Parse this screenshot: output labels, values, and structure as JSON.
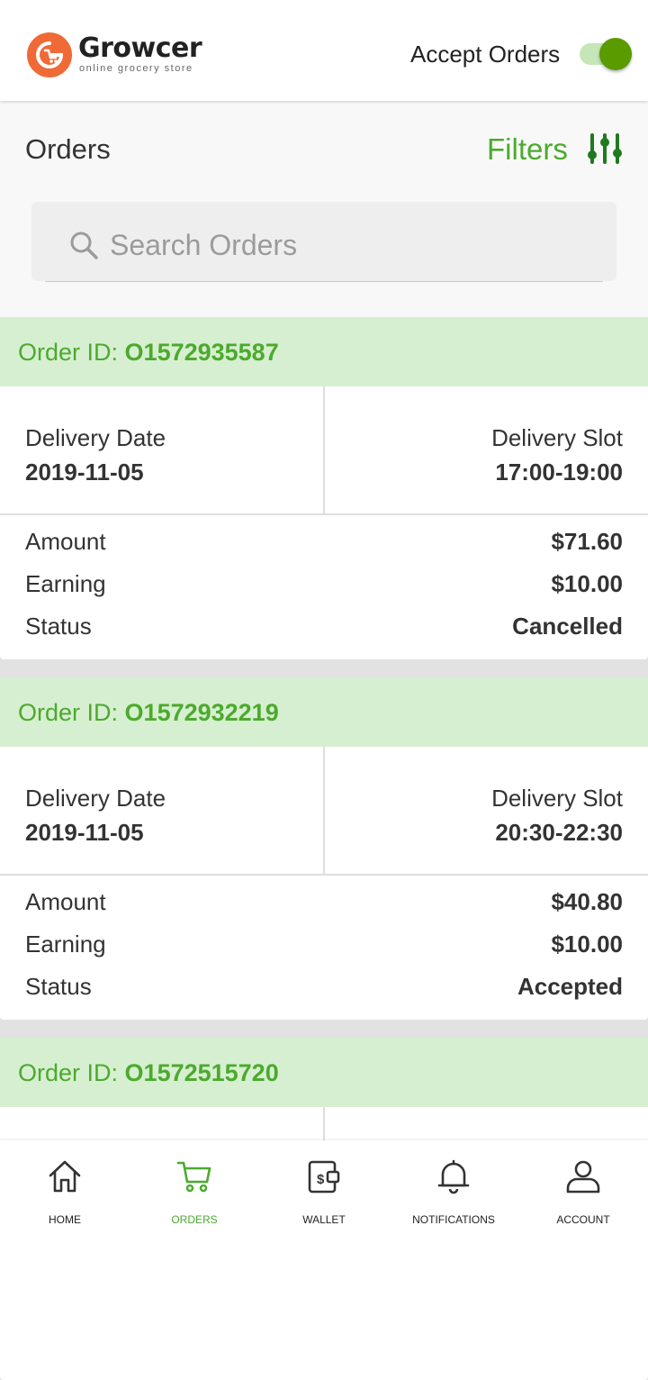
{
  "app": {
    "brand_name": "Growcer",
    "tagline": "online grocery store",
    "logo_icon": "growcer-logo-icon",
    "accept_orders_label": "Accept Orders",
    "accept_orders_on": true
  },
  "page": {
    "title": "Orders",
    "filters_label": "Filters",
    "search_placeholder": "Search Orders",
    "search_value": ""
  },
  "labels": {
    "order_id": "Order ID:",
    "delivery_date": "Delivery Date",
    "delivery_slot": "Delivery Slot",
    "amount": "Amount",
    "earning": "Earning",
    "status": "Status"
  },
  "orders": [
    {
      "id": "O1572935587",
      "delivery_date": "2019-11-05",
      "delivery_slot": "17:00-19:00",
      "amount": "$71.60",
      "earning": "$10.00",
      "status": "Cancelled"
    },
    {
      "id": "O1572932219",
      "delivery_date": "2019-11-05",
      "delivery_slot": "20:30-22:30",
      "amount": "$40.80",
      "earning": "$10.00",
      "status": "Accepted"
    },
    {
      "id": "O1572515720",
      "delivery_date": "",
      "delivery_slot": "",
      "amount": "",
      "earning": "",
      "status": ""
    }
  ],
  "bottom_nav": [
    {
      "label": "HOME",
      "icon": "home-icon",
      "active": false
    },
    {
      "label": "ORDERS",
      "icon": "cart-icon",
      "active": true
    },
    {
      "label": "WALLET",
      "icon": "wallet-icon",
      "active": false
    },
    {
      "label": "NOTIFICATIONS",
      "icon": "bell-icon",
      "active": false
    },
    {
      "label": "ACCOUNT",
      "icon": "user-icon",
      "active": false
    }
  ],
  "colors": {
    "accent_green": "#4caa2d",
    "header_green_bg": "#d6efd1",
    "toggle_green": "#5a9b00",
    "logo_orange": "#ef6a36"
  }
}
